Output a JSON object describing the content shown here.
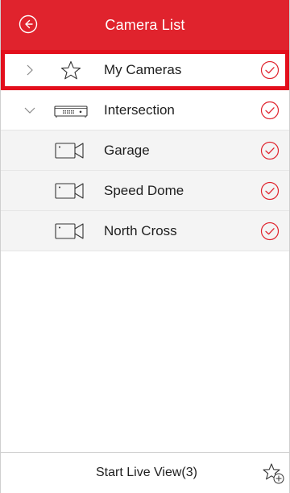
{
  "header": {
    "title": "Camera List",
    "back_icon": "circle-back-arrow-icon",
    "bg_color": "#e0232d"
  },
  "list": {
    "items": [
      {
        "label": "My Cameras",
        "type": "favorites",
        "icon": "star-outline-icon",
        "expand_icon": "chevron-right-icon",
        "checked": true,
        "highlighted": true
      },
      {
        "label": "Intersection",
        "type": "device",
        "icon": "dvr-device-icon",
        "expand_icon": "chevron-down-icon",
        "checked": true,
        "highlighted": false
      },
      {
        "label": "Garage",
        "type": "camera",
        "icon": "camera-icon",
        "checked": true
      },
      {
        "label": "Speed Dome",
        "type": "camera",
        "icon": "camera-icon",
        "checked": true
      },
      {
        "label": "North Cross",
        "type": "camera",
        "icon": "camera-icon",
        "checked": true
      }
    ],
    "check_icon": "circle-check-icon",
    "accent_color": "#e0232d",
    "highlight_color": "#e30f1c"
  },
  "footer": {
    "start_live_label": "Start Live View(3)",
    "add_favorite_icon": "star-plus-icon"
  }
}
